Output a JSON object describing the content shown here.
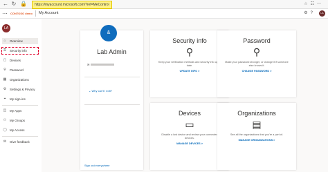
{
  "browser": {
    "url": "https://myaccount.microsoft.com/?ref=MeControl"
  },
  "header": {
    "logo": "CONTOSO demo",
    "title": "My Account",
    "avatar": "LA"
  },
  "sidebar": {
    "avatar": "LA",
    "items": [
      {
        "label": "Overview"
      },
      {
        "label": "Security info"
      },
      {
        "label": "Devices"
      },
      {
        "label": "Password"
      },
      {
        "label": "Organizations"
      },
      {
        "label": "Settings & Privacy"
      },
      {
        "label": "My sign-ins"
      },
      {
        "label": "My Apps"
      },
      {
        "label": "My Groups"
      },
      {
        "label": "My Access"
      },
      {
        "label": "Give feedback"
      }
    ]
  },
  "profile": {
    "avatar": "&",
    "name": "Lab Admin",
    "email_prefix": "✉",
    "why_cant_i_edit": "Why can't I edit?",
    "sign_out": "Sign out everywhere"
  },
  "cards": {
    "security": {
      "title": "Security info",
      "desc": "Keep your verification methods and security info up to date.",
      "link": "UPDATE INFO >"
    },
    "password": {
      "title": "Password",
      "desc": "Make your password stronger, or change it if someone else knows it.",
      "link": "CHANGE PASSWORD >"
    },
    "devices": {
      "title": "Devices",
      "desc": "Disable a lost device and review your connected devices.",
      "link": "MANAGE DEVICES >"
    },
    "organizations": {
      "title": "Organizations",
      "desc": "See all the organizations that you're a part of.",
      "link": "MANAGE ORGANIZATIONS >"
    }
  },
  "colors": {
    "accent": "#0067b8",
    "highlight": "#e0002a",
    "url_highlight": "#fff38a",
    "avatar": "#8b2c2c"
  }
}
